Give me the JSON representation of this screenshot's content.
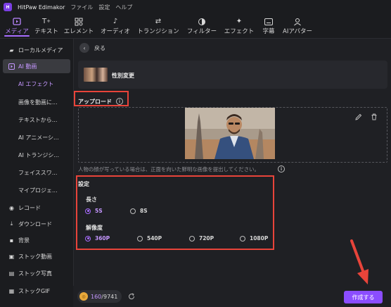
{
  "app": {
    "title": "HitPaw Edimakor",
    "menu": [
      "ファイル",
      "設定",
      "ヘルプ"
    ]
  },
  "toolbar": [
    {
      "label": "メディア",
      "icon": "media-icon"
    },
    {
      "label": "テキスト",
      "icon": "text-icon"
    },
    {
      "label": "エレメント",
      "icon": "element-icon"
    },
    {
      "label": "オーディオ",
      "icon": "audio-icon"
    },
    {
      "label": "トランジション",
      "icon": "transition-icon"
    },
    {
      "label": "フィルター",
      "icon": "filter-icon"
    },
    {
      "label": "エフェクト",
      "icon": "effect-icon"
    },
    {
      "label": "字幕",
      "icon": "subtitle-icon"
    },
    {
      "label": "AIアバター",
      "icon": "ai-avatar-icon"
    }
  ],
  "sidebar": {
    "items": [
      {
        "label": "ローカルメディア",
        "icon": "folder-icon"
      },
      {
        "label": "AI 動画",
        "icon": "ai-video-icon"
      },
      {
        "label": "レコード",
        "icon": "record-icon"
      },
      {
        "label": "ダウンロード",
        "icon": "download-icon"
      },
      {
        "label": "背景",
        "icon": "background-icon"
      },
      {
        "label": "ストック動画",
        "icon": "stock-video-icon"
      },
      {
        "label": "ストック写真",
        "icon": "stock-photo-icon"
      },
      {
        "label": "ストックGIF",
        "icon": "stock-gif-icon"
      }
    ],
    "sub_items": [
      "AI エフェクト",
      "画像を動画に...",
      "テキストから...",
      "AI アニメーシ...",
      "AI トランジシ...",
      "フェイススワ...",
      "マイプロジェ..."
    ]
  },
  "main": {
    "back_label": "戻る",
    "effect_name": "性別変更",
    "upload_label": "アップロード",
    "hint": "人物の顔が写っている場合は、正面を向いた鮮明な画像を提出してください。",
    "settings_label": "設定",
    "length_label": "長さ",
    "length_options": [
      "5S",
      "8S"
    ],
    "length_selected": "5S",
    "resolution_label": "解像度",
    "resolution_options": [
      "360P",
      "540P",
      "720P",
      "1080P"
    ],
    "resolution_selected": "360P"
  },
  "footer": {
    "credits_used": "160",
    "credits_total": "/9741",
    "generate_label": "作成する"
  },
  "colors": {
    "accent": "#a86cff",
    "highlight_box": "#e8443a",
    "button": "#8b4dff"
  }
}
